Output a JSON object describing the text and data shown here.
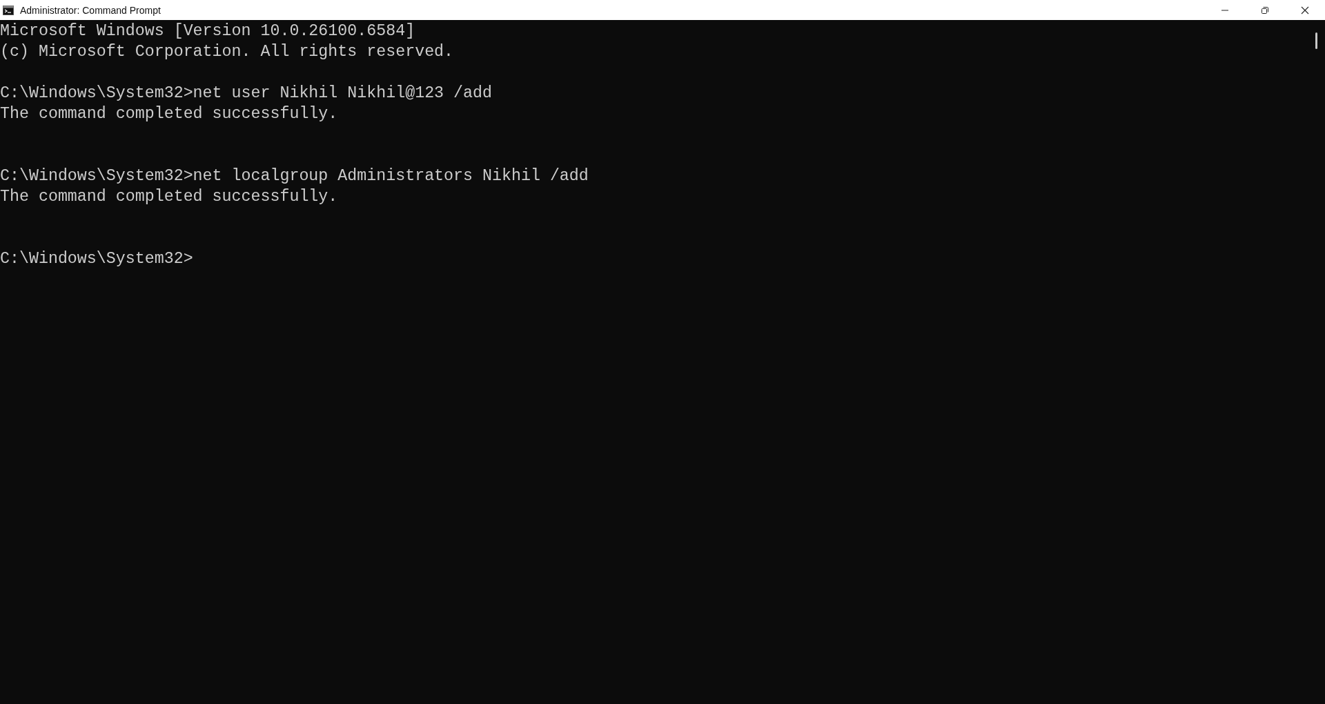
{
  "window": {
    "title": "Administrator: Command Prompt"
  },
  "console": {
    "header": [
      "Microsoft Windows [Version 10.0.26100.6584]",
      "(c) Microsoft Corporation. All rights reserved."
    ],
    "sessions": [
      {
        "input": "C:\\Windows\\System32>net user Nikhil Nikhil@123 /add",
        "output": [
          "The command completed successfully."
        ]
      },
      {
        "input": "C:\\Windows\\System32>net localgroup Administrators Nikhil /add",
        "output": [
          "The command completed successfully."
        ]
      }
    ],
    "prompt": "C:\\Windows\\System32>"
  }
}
